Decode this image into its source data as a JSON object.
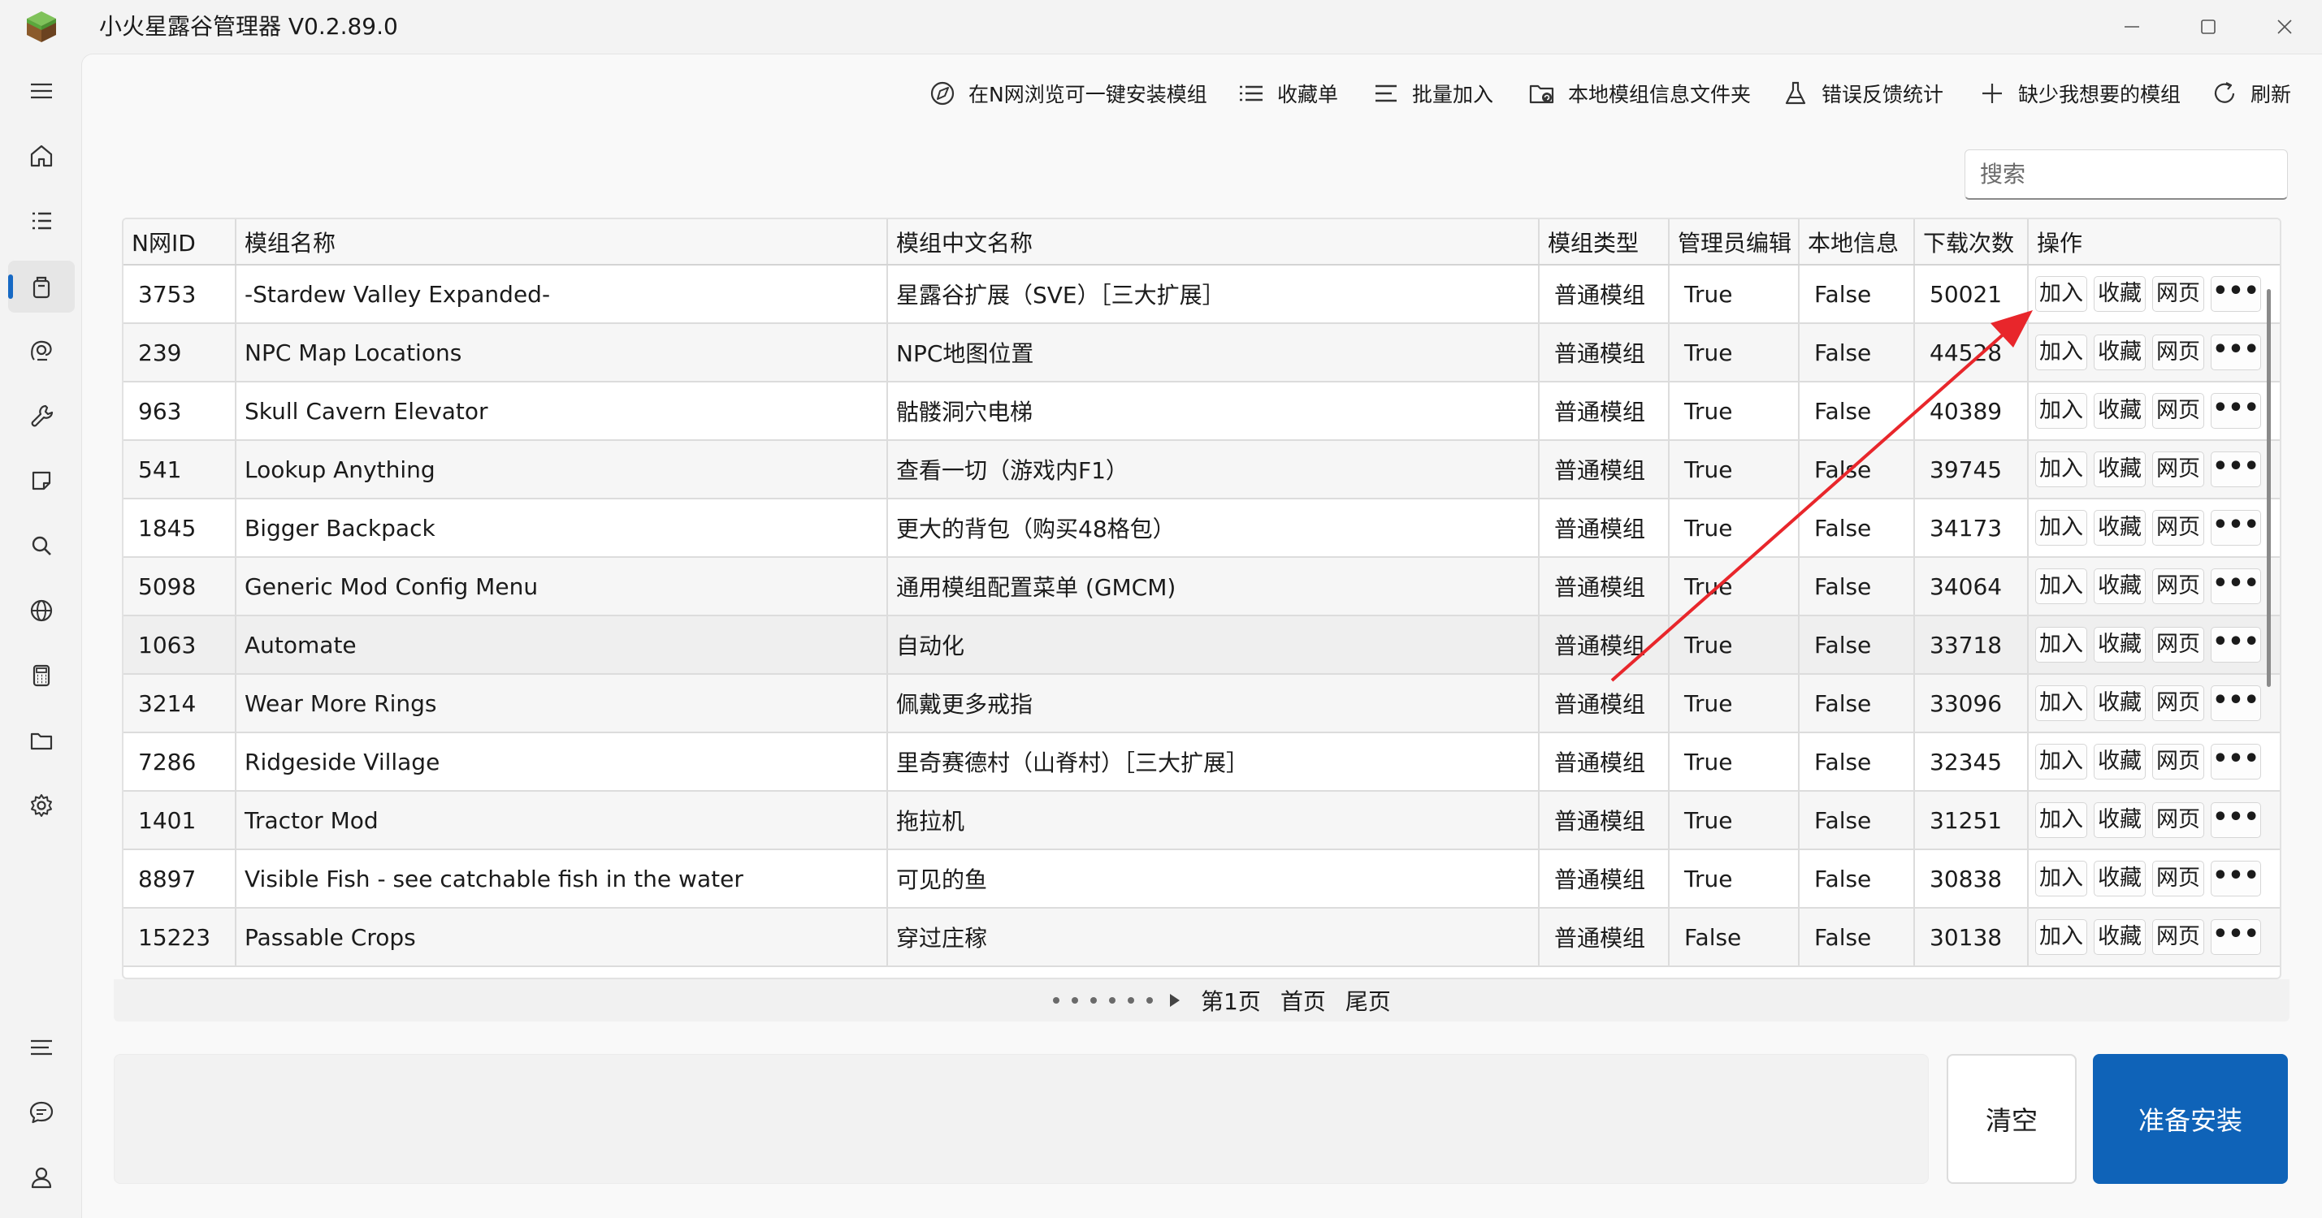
{
  "window": {
    "title": "小火星露谷管理器 V0.2.89.0"
  },
  "nav": {
    "items": [
      "menu-icon",
      "home-icon",
      "list-icon",
      "package-icon",
      "camera-icon",
      "wrench-icon",
      "note-icon",
      "search-icon",
      "globe-icon",
      "calculator-icon",
      "folder-icon",
      "gear-icon"
    ],
    "bottom_items": [
      "lines-icon",
      "chat-icon",
      "user-icon"
    ],
    "active": "package-icon"
  },
  "toolbar": {
    "browse": "在N网浏览可一键安装模组",
    "favorites": "收藏单",
    "batch_add": "批量加入",
    "local_folder": "本地模组信息文件夹",
    "feedback": "错误反馈统计",
    "missing": "缺少我想要的模组",
    "refresh": "刷新"
  },
  "search": {
    "placeholder": "搜索"
  },
  "table": {
    "headers": [
      "N网ID",
      "模组名称",
      "模组中文名称",
      "模组类型",
      "管理员编辑",
      "本地信息",
      "下载次数",
      "操作"
    ],
    "action_labels": {
      "add": "加入",
      "favorite": "收藏",
      "web": "网页",
      "more": "•••"
    },
    "rows": [
      {
        "id": "3753",
        "name": "-Stardew Valley Expanded-",
        "cn": "星露谷扩展（SVE）［三大扩展］",
        "type": "普通模组",
        "admin": "True",
        "local": "False",
        "downloads": "50021"
      },
      {
        "id": "239",
        "name": "NPC Map Locations",
        "cn": "NPC地图位置",
        "type": "普通模组",
        "admin": "True",
        "local": "False",
        "downloads": "44528"
      },
      {
        "id": "963",
        "name": "Skull Cavern Elevator",
        "cn": "骷髅洞穴电梯",
        "type": "普通模组",
        "admin": "True",
        "local": "False",
        "downloads": "40389"
      },
      {
        "id": "541",
        "name": "Lookup Anything",
        "cn": "查看一切（游戏内F1）",
        "type": "普通模组",
        "admin": "True",
        "local": "False",
        "downloads": "39745"
      },
      {
        "id": "1845",
        "name": "Bigger Backpack",
        "cn": "更大的背包（购买48格包）",
        "type": "普通模组",
        "admin": "True",
        "local": "False",
        "downloads": "34173"
      },
      {
        "id": "5098",
        "name": "Generic Mod Config Menu",
        "cn": "通用模组配置菜单 (GMCM)",
        "type": "普通模组",
        "admin": "True",
        "local": "False",
        "downloads": "34064"
      },
      {
        "id": "1063",
        "name": "Automate",
        "cn": "自动化",
        "type": "普通模组",
        "admin": "True",
        "local": "False",
        "downloads": "33718"
      },
      {
        "id": "3214",
        "name": "Wear More Rings",
        "cn": "佩戴更多戒指",
        "type": "普通模组",
        "admin": "True",
        "local": "False",
        "downloads": "33096"
      },
      {
        "id": "7286",
        "name": "Ridgeside Village",
        "cn": "里奇赛德村（山脊村）［三大扩展］",
        "type": "普通模组",
        "admin": "True",
        "local": "False",
        "downloads": "32345"
      },
      {
        "id": "1401",
        "name": "Tractor Mod",
        "cn": "拖拉机",
        "type": "普通模组",
        "admin": "True",
        "local": "False",
        "downloads": "31251"
      },
      {
        "id": "8897",
        "name": "Visible Fish - see catchable fish in the water",
        "cn": "可见的鱼",
        "type": "普通模组",
        "admin": "True",
        "local": "False",
        "downloads": "30838"
      },
      {
        "id": "15223",
        "name": "Passable Crops",
        "cn": "穿过庄稼",
        "type": "普通模组",
        "admin": "False",
        "local": "False",
        "downloads": "30138"
      }
    ]
  },
  "pager": {
    "current": "第1页",
    "first": "首页",
    "last": "尾页"
  },
  "actions": {
    "clear": "清空",
    "install": "准备安装"
  },
  "colors": {
    "accent": "#0f63b8",
    "annotation_arrow": "#e8262b"
  }
}
